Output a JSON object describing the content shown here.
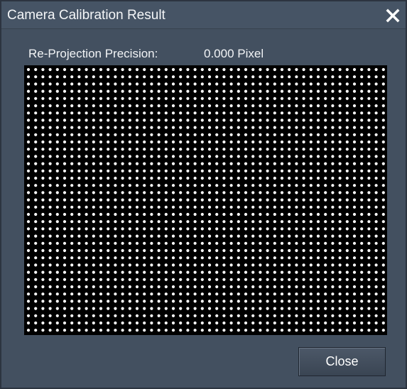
{
  "window": {
    "title": "Camera Calibration Result",
    "close_icon": "close-icon"
  },
  "result": {
    "precision_label": "Re-Projection Precision:",
    "precision_value": "0.000 Pixel"
  },
  "grid": {
    "dot_color": "#ffffff",
    "background_color": "#000000"
  },
  "footer": {
    "close_label": "Close"
  }
}
